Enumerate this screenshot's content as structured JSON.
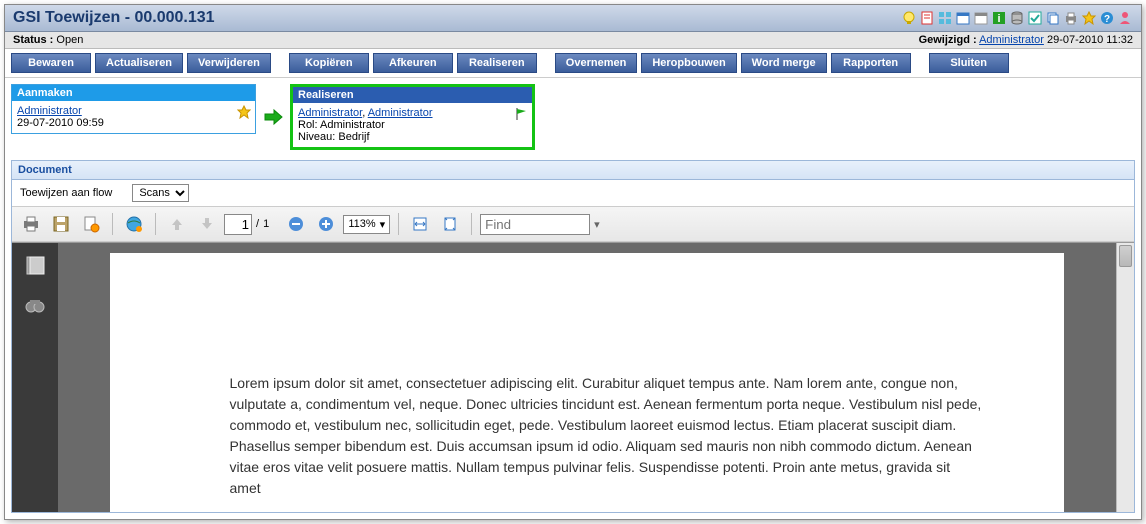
{
  "title": "GSI Toewijzen - 00.000.131",
  "status": {
    "label": "Status :",
    "value": "Open"
  },
  "modified": {
    "label": "Gewijzigd :",
    "user": "Administrator",
    "datetime": "29-07-2010 11:32"
  },
  "buttons": {
    "bewaren": "Bewaren",
    "actualiseren": "Actualiseren",
    "verwijderen": "Verwijderen",
    "kopieren": "Kopiëren",
    "afkeuren": "Afkeuren",
    "realiseren": "Realiseren",
    "overnemen": "Overnemen",
    "heropbouwen": "Heropbouwen",
    "wordmerge": "Word merge",
    "rapporten": "Rapporten",
    "sluiten": "Sluiten"
  },
  "workflow": {
    "aanmaken": {
      "header": "Aanmaken",
      "user": "Administrator",
      "datetime": "29-07-2010 09:59"
    },
    "realiseren": {
      "header": "Realiseren",
      "user1": "Administrator",
      "user2": "Administrator",
      "rol_label": "Rol:",
      "rol": "Administrator",
      "niveau_label": "Niveau:",
      "niveau": "Bedrijf"
    }
  },
  "document": {
    "section_header": "Document",
    "filter_label": "Toewijzen aan flow",
    "filter_value": "Scans"
  },
  "viewer": {
    "page_current": "1",
    "page_sep": "/",
    "page_total": "1",
    "zoom": "113%",
    "find_placeholder": "Find",
    "body_text": "Lorem ipsum dolor sit amet, consectetuer adipiscing elit. Curabitur aliquet tempus ante. Nam lorem ante, congue non, vulputate a, condimentum vel, neque. Donec ultricies tincidunt est. Aenean fermentum porta neque. Vestibulum nisl pede, commodo et, vestibulum nec, sollicitudin eget, pede. Vestibulum laoreet euismod lectus. Etiam placerat suscipit diam. Phasellus semper bibendum est. Duis accumsan ipsum id odio. Aliquam sed mauris non nibh commodo dictum. Aenean vitae eros vitae velit posuere mattis. Nullam tempus pulvinar felis. Suspendisse potenti. Proin ante metus, gravida sit amet"
  }
}
